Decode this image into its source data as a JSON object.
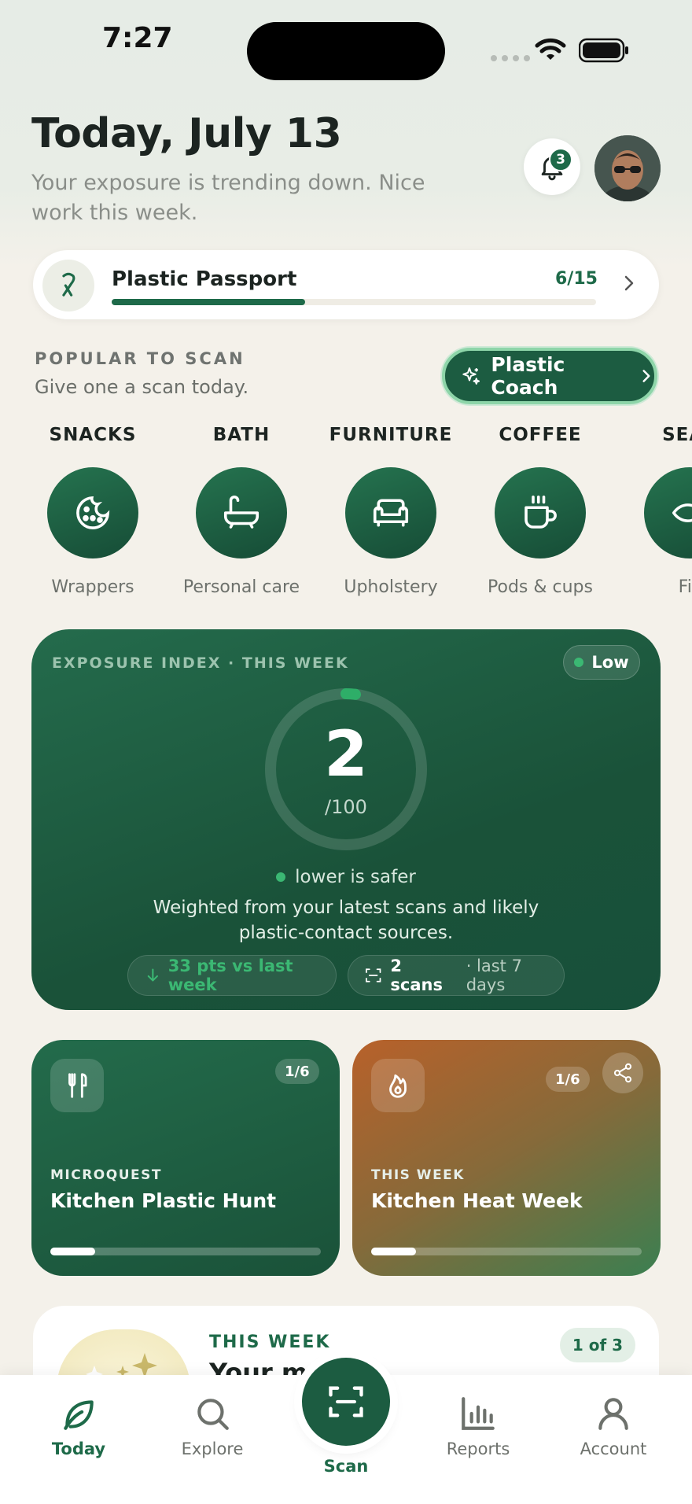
{
  "status_bar": {
    "time": "7:27"
  },
  "header": {
    "title": "Today, July 13",
    "subtitle": "Your exposure is trending down. Nice work this week.",
    "notification_count": "3"
  },
  "passport": {
    "title": "Plastic Passport",
    "count": "6/15",
    "progress": 0.4
  },
  "popular": {
    "label": "POPULAR TO SCAN",
    "subtitle": "Give one a scan today.",
    "coach_label": "Plastic Coach",
    "categories": [
      {
        "title": "SNACKS",
        "subtitle": "Wrappers",
        "icon": "cookie-icon"
      },
      {
        "title": "BATH",
        "subtitle": "Personal care",
        "icon": "bathtub-icon"
      },
      {
        "title": "FURNITURE",
        "subtitle": "Upholstery",
        "icon": "sofa-icon"
      },
      {
        "title": "COFFEE",
        "subtitle": "Pods & cups",
        "icon": "coffee-cup-icon"
      },
      {
        "title": "SEAF",
        "subtitle": "Fis",
        "icon": "fish-icon"
      }
    ]
  },
  "exposure": {
    "label": "EXPOSURE INDEX · THIS WEEK",
    "level": "Low",
    "score": "2",
    "score_max": "/100",
    "score_fraction": 0.02,
    "hint": "lower is safer",
    "description": "Weighted from your latest scans and likely plastic-contact sources.",
    "delta": "33 pts vs last week",
    "scans_count": "2 scans",
    "scans_period": "· last 7 days"
  },
  "quests": [
    {
      "kicker": "MICROQUEST",
      "title": "Kitchen Plastic Hunt",
      "fraction": "1/6",
      "progress": 0.1667,
      "icon": "fork-knife-icon"
    },
    {
      "kicker": "THIS WEEK",
      "title": "Kitchen Heat Week",
      "fraction": "1/6",
      "progress": 0.1667,
      "icon": "flame-icon"
    }
  ],
  "peek_card": {
    "kicker": "THIS WEEK",
    "title": "Your mo",
    "badge": "1 of 3"
  },
  "tabs": [
    {
      "label": "Today",
      "icon": "leaf-icon",
      "active": true
    },
    {
      "label": "Explore",
      "icon": "search-icon"
    },
    {
      "label": "Scan",
      "icon": "scan-icon"
    },
    {
      "label": "Reports",
      "icon": "bar-chart-icon"
    },
    {
      "label": "Account",
      "icon": "user-icon"
    }
  ],
  "colors": {
    "brand": "#1e6a49",
    "accent_green": "#3bb873",
    "background": "#f4f1ea"
  }
}
